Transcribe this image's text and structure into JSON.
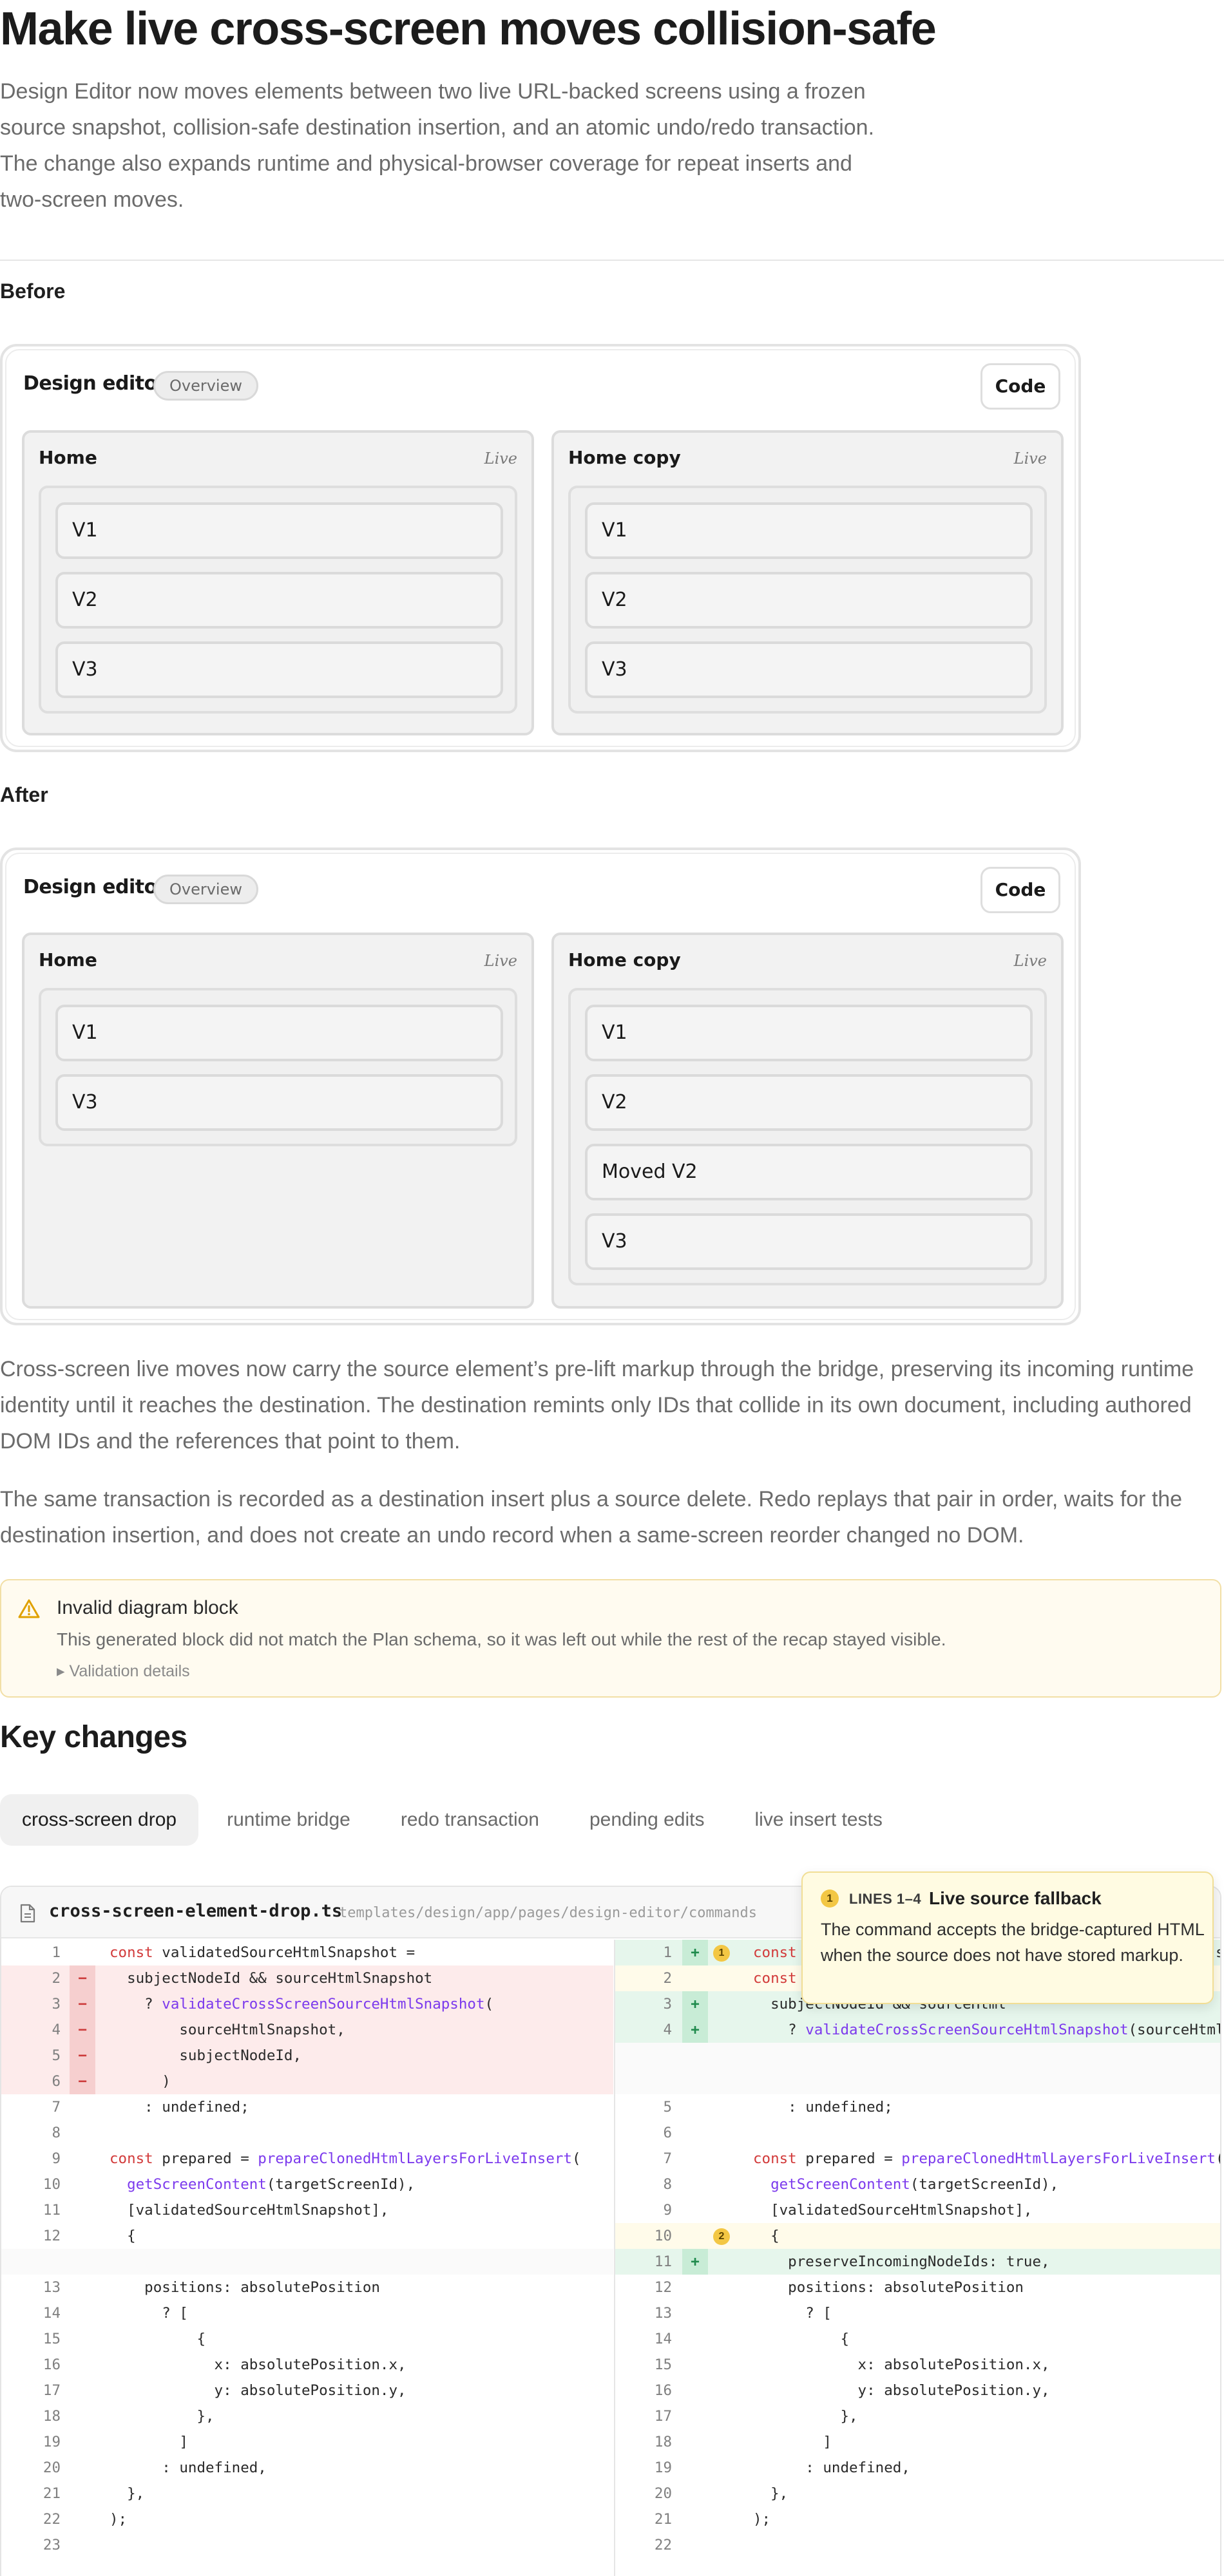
{
  "header": {
    "title": "Make live cross-screen moves collision-safe",
    "lead": "Design Editor now moves elements between two live URL-backed screens using a frozen source snapshot, collision-safe destination insertion, and an atomic undo/redo transaction. The change also expands runtime and physical-browser coverage for repeat inserts and two-screen moves."
  },
  "before": {
    "label": "Before",
    "app_title": "Design editor",
    "pill": "Overview",
    "code_button": "Code",
    "screens": [
      {
        "name": "Home",
        "status": "Live",
        "items": [
          "V1",
          "V2",
          "V3"
        ]
      },
      {
        "name": "Home copy",
        "status": "Live",
        "items": [
          "V1",
          "V2",
          "V3"
        ]
      }
    ]
  },
  "after": {
    "label": "After",
    "app_title": "Design editor",
    "pill": "Overview",
    "code_button": "Code",
    "screens": [
      {
        "name": "Home",
        "status": "Live",
        "items": [
          "V1",
          "V3"
        ]
      },
      {
        "name": "Home copy",
        "status": "Live",
        "items": [
          "V1",
          "V2",
          "Moved V2",
          "V3"
        ]
      }
    ]
  },
  "body": {
    "p1": "Cross-screen live moves now carry the source element’s pre-lift markup through the bridge, preserving its incoming runtime identity until it reaches the destination. The destination remints only IDs that collide in its own document, including authored DOM IDs and the references that point to them.",
    "p2": "The same transaction is recorded as a destination insert plus a source delete. Redo replays that pair in order, waits for the destination insertion, and does not create an undo record when a same-screen reorder changed no DOM."
  },
  "alert": {
    "title": "Invalid diagram block",
    "body": "This generated block did not match the Plan schema, so it was left out while the rest of the recap stayed visible.",
    "details": "▸ Validation details"
  },
  "key_changes": {
    "title": "Key changes",
    "tabs": [
      {
        "label": "cross-screen drop",
        "active": true
      },
      {
        "label": "runtime bridge",
        "active": false
      },
      {
        "label": "redo transaction",
        "active": false
      },
      {
        "label": "pending edits",
        "active": false
      },
      {
        "label": "live insert tests",
        "active": false
      }
    ]
  },
  "diff": {
    "file_name": "cross-screen-element-drop.ts",
    "file_path": "templates/design/app/pages/design-editor/commands",
    "left": [
      {
        "ln": "1",
        "type": "ctx",
        "code": "const validatedSourceHtmlSnapshot ="
      },
      {
        "ln": "2",
        "type": "del",
        "code": "  subjectNodeId && sourceHtmlSnapshot"
      },
      {
        "ln": "3",
        "type": "del",
        "code": "    ? validateCrossScreenSourceHtmlSnapshot("
      },
      {
        "ln": "4",
        "type": "del",
        "code": "        sourceHtmlSnapshot,"
      },
      {
        "ln": "5",
        "type": "del",
        "code": "        subjectNodeId,"
      },
      {
        "ln": "6",
        "type": "del",
        "code": "      )"
      },
      {
        "ln": "7",
        "type": "ctx",
        "code": "    : undefined;"
      },
      {
        "ln": "8",
        "type": "ctx",
        "code": ""
      },
      {
        "ln": "9",
        "type": "ctx",
        "code": "const prepared = prepareClonedHtmlLayersForLiveInsert("
      },
      {
        "ln": "10",
        "type": "ctx",
        "code": "  getScreenContent(targetScreenId),"
      },
      {
        "ln": "11",
        "type": "ctx",
        "code": "  [validatedSourceHtmlSnapshot],"
      },
      {
        "ln": "12",
        "type": "ctx",
        "code": "  {"
      },
      {
        "ln": "",
        "type": "gap",
        "code": ""
      },
      {
        "ln": "13",
        "type": "ctx",
        "code": "    positions: absolutePosition"
      },
      {
        "ln": "14",
        "type": "ctx",
        "code": "      ? ["
      },
      {
        "ln": "15",
        "type": "ctx",
        "code": "          {"
      },
      {
        "ln": "16",
        "type": "ctx",
        "code": "            x: absolutePosition.x,"
      },
      {
        "ln": "17",
        "type": "ctx",
        "code": "            y: absolutePosition.y,"
      },
      {
        "ln": "18",
        "type": "ctx",
        "code": "          },"
      },
      {
        "ln": "19",
        "type": "ctx",
        "code": "        ]"
      },
      {
        "ln": "20",
        "type": "ctx",
        "code": "      : undefined,"
      },
      {
        "ln": "21",
        "type": "ctx",
        "code": "  },"
      },
      {
        "ln": "22",
        "type": "ctx",
        "code": ");"
      },
      {
        "ln": "23",
        "type": "ctx",
        "code": ""
      }
    ],
    "right": [
      {
        "ln": "1",
        "type": "add",
        "note": "1",
        "code": "const validatedSourceHtmlSnapshot = subjectNodeId && sourceHtmlSnapshot"
      },
      {
        "ln": "2",
        "type": "anno",
        "code": "const"
      },
      {
        "ln": "3",
        "type": "add",
        "code": "  subjectNodeId && sourceHtml"
      },
      {
        "ln": "4",
        "type": "add",
        "code": "    ? validateCrossScreenSourceHtmlSnapshot(sourceHtml"
      },
      {
        "ln": "",
        "type": "gap",
        "code": ""
      },
      {
        "ln": "",
        "type": "gap",
        "code": ""
      },
      {
        "ln": "5",
        "type": "ctx",
        "code": "    : undefined;"
      },
      {
        "ln": "6",
        "type": "ctx",
        "code": ""
      },
      {
        "ln": "7",
        "type": "ctx",
        "code": "const prepared = prepareClonedHtmlLayersForLiveInsert("
      },
      {
        "ln": "8",
        "type": "ctx",
        "code": "  getScreenContent(targetScreenId),"
      },
      {
        "ln": "9",
        "type": "ctx",
        "code": "  [validatedSourceHtmlSnapshot],"
      },
      {
        "ln": "10",
        "type": "anno",
        "note": "2",
        "code": "  {"
      },
      {
        "ln": "11",
        "type": "add",
        "code": "    preserveIncomingNodeIds: true,"
      },
      {
        "ln": "12",
        "type": "ctx",
        "code": "    positions: absolutePosition"
      },
      {
        "ln": "13",
        "type": "ctx",
        "code": "      ? ["
      },
      {
        "ln": "14",
        "type": "ctx",
        "code": "          {"
      },
      {
        "ln": "15",
        "type": "ctx",
        "code": "            x: absolutePosition.x,"
      },
      {
        "ln": "16",
        "type": "ctx",
        "code": "            y: absolutePosition.y,"
      },
      {
        "ln": "17",
        "type": "ctx",
        "code": "          },"
      },
      {
        "ln": "18",
        "type": "ctx",
        "code": "        ]"
      },
      {
        "ln": "19",
        "type": "ctx",
        "code": "      : undefined,"
      },
      {
        "ln": "20",
        "type": "ctx",
        "code": "  },"
      },
      {
        "ln": "21",
        "type": "ctx",
        "code": ");"
      },
      {
        "ln": "22",
        "type": "ctx",
        "code": ""
      }
    ]
  },
  "popover": {
    "badge": "1",
    "lines": "LINES 1–4",
    "title": "Live source fallback",
    "body": "The command accepts the bridge-captured HTML when the source does not have stored markup."
  }
}
